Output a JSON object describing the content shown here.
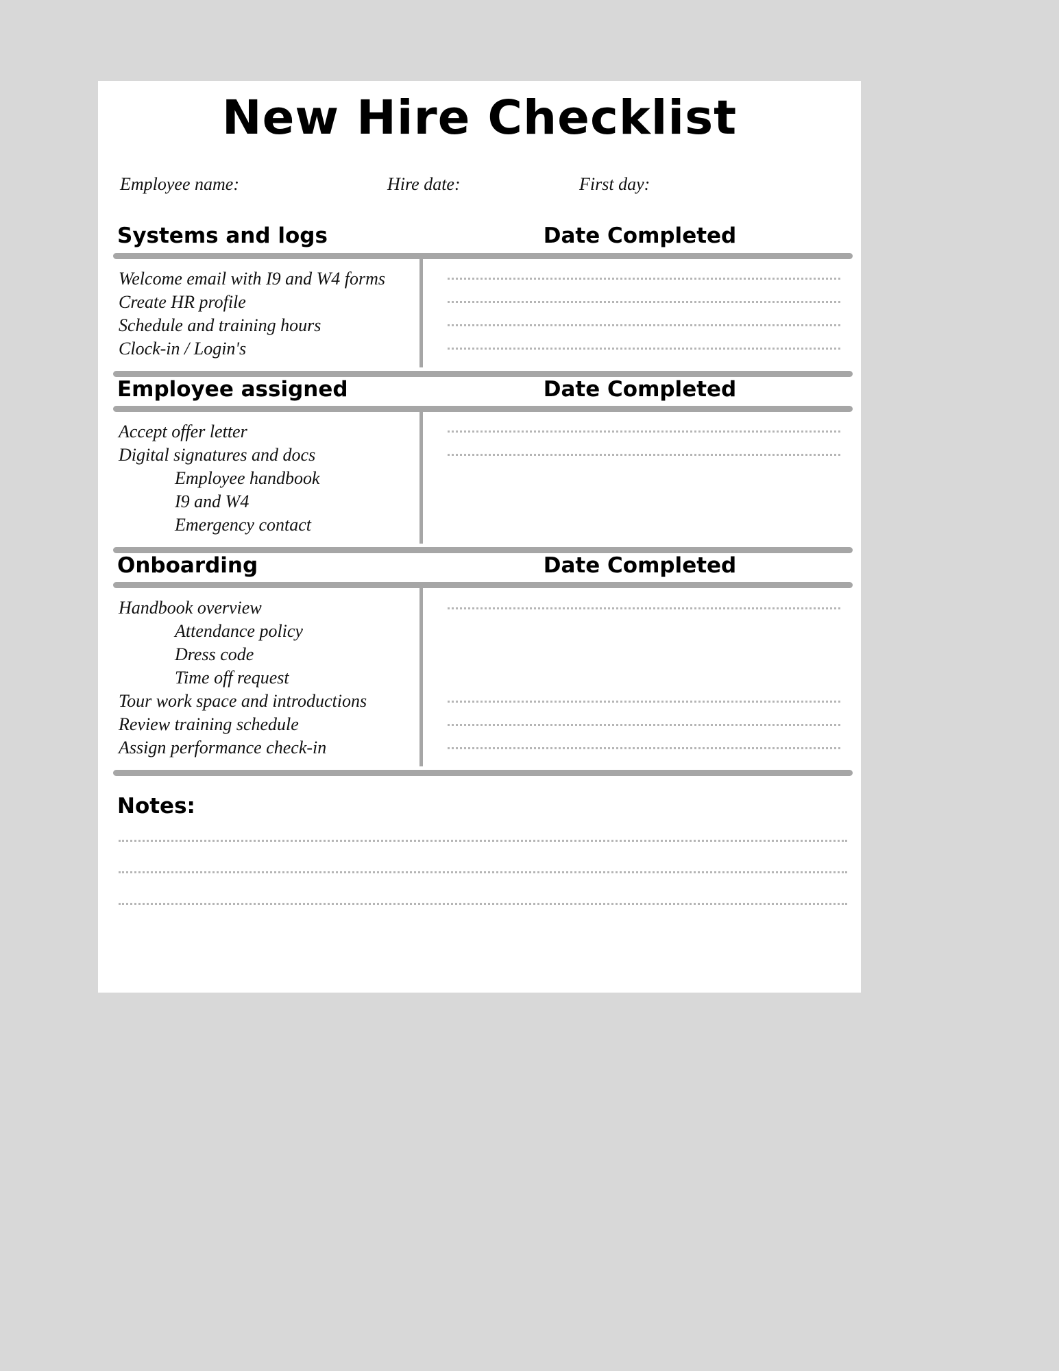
{
  "document": {
    "title": "New Hire Checklist",
    "meta": {
      "employee_name_label": "Employee name:",
      "hire_date_label": "Hire date:",
      "first_day_label": "First day:"
    },
    "date_completed_label": "Date Completed",
    "sections": [
      {
        "title": "Systems and logs",
        "items": [
          {
            "text": "Welcome email with I9 and W4 forms",
            "indent": false
          },
          {
            "text": "Create HR profile",
            "indent": false
          },
          {
            "text": "Schedule and training hours",
            "indent": false
          },
          {
            "text": "Clock-in / Login's",
            "indent": false
          }
        ],
        "date_lines": [
          true,
          true,
          true,
          true
        ]
      },
      {
        "title": "Employee assigned",
        "items": [
          {
            "text": "Accept offer letter",
            "indent": false
          },
          {
            "text": "Digital signatures  and docs",
            "indent": false
          },
          {
            "text": "Employee handbook",
            "indent": true
          },
          {
            "text": "I9 and W4",
            "indent": true
          },
          {
            "text": "Emergency contact",
            "indent": true
          }
        ],
        "date_lines": [
          true,
          true,
          false,
          false,
          false
        ]
      },
      {
        "title": "Onboarding",
        "items": [
          {
            "text": "Handbook overview",
            "indent": false
          },
          {
            "text": "Attendance policy",
            "indent": true
          },
          {
            "text": "Dress code",
            "indent": true
          },
          {
            "text": "Time off request",
            "indent": true
          },
          {
            "text": "Tour work space and introductions",
            "indent": false
          },
          {
            "text": "Review training schedule",
            "indent": false
          },
          {
            "text": "Assign performance check-in",
            "indent": false
          }
        ],
        "date_lines": [
          true,
          false,
          false,
          false,
          true,
          true,
          true
        ]
      }
    ],
    "notes": {
      "title": "Notes:",
      "line_count": 3
    },
    "colors": {
      "rule": "#a6a6a6",
      "dotted": "#b5b5b5",
      "page_background": "#ffffff",
      "canvas_background": "#d8d8d8",
      "text": "#111111"
    }
  }
}
